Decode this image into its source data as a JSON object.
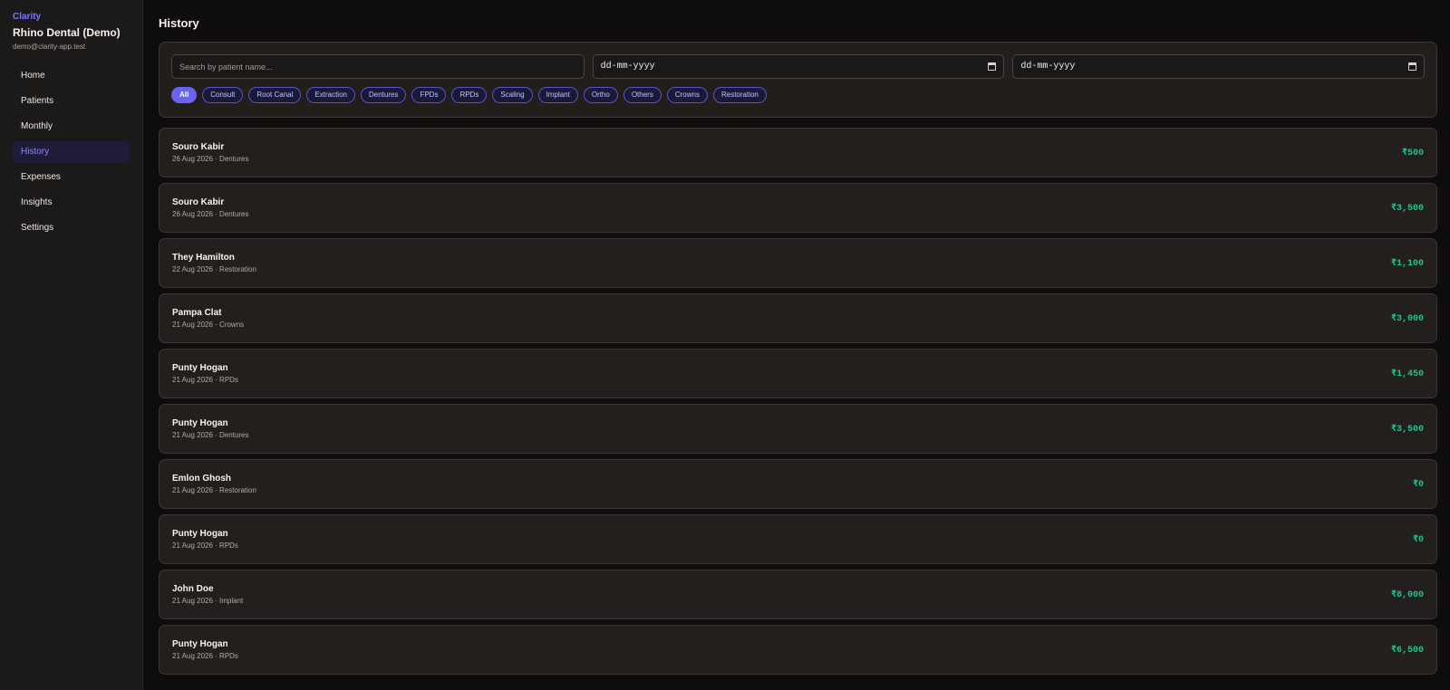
{
  "app": {
    "brand": "Clarity",
    "clinic": "Rhino Dental (Demo)",
    "email": "demo@clarity-app.test"
  },
  "nav": [
    {
      "label": "Home",
      "active": false
    },
    {
      "label": "Patients",
      "active": false
    },
    {
      "label": "Monthly",
      "active": false
    },
    {
      "label": "History",
      "active": true
    },
    {
      "label": "Expenses",
      "active": false
    },
    {
      "label": "Insights",
      "active": false
    },
    {
      "label": "Settings",
      "active": false
    }
  ],
  "page": {
    "title": "History"
  },
  "filters": {
    "search_placeholder": "Search by patient name...",
    "date_from": "dd-mm-yyyy",
    "date_to": "dd-mm-yyyy",
    "chips": [
      "All",
      "Consult",
      "Root Canal",
      "Extraction",
      "Dentures",
      "FPDs",
      "RPDs",
      "Scaling",
      "Implant",
      "Ortho",
      "Others",
      "Crowns",
      "Restoration"
    ],
    "active_chip": "All"
  },
  "records": [
    {
      "name": "Souro Kabir",
      "meta": "26 Aug 2026 · Dentures",
      "amount": "₹500"
    },
    {
      "name": "Souro Kabir",
      "meta": "26 Aug 2026 · Dentures",
      "amount": "₹3,500"
    },
    {
      "name": "They Hamilton",
      "meta": "22 Aug 2026 · Restoration",
      "amount": "₹1,100"
    },
    {
      "name": "Pampa Clat",
      "meta": "21 Aug 2026 · Crowns",
      "amount": "₹3,000"
    },
    {
      "name": "Punty Hogan",
      "meta": "21 Aug 2026 · RPDs",
      "amount": "₹1,450"
    },
    {
      "name": "Punty Hogan",
      "meta": "21 Aug 2026 · Dentures",
      "amount": "₹3,500"
    },
    {
      "name": "Emlon Ghosh",
      "meta": "21 Aug 2026 · Restoration",
      "amount": "₹0"
    },
    {
      "name": "Punty Hogan",
      "meta": "21 Aug 2026 · RPDs",
      "amount": "₹0"
    },
    {
      "name": "John Doe",
      "meta": "21 Aug 2026 · Implant",
      "amount": "₹8,000"
    },
    {
      "name": "Punty Hogan",
      "meta": "21 Aug 2026 · RPDs",
      "amount": "₹6,500"
    }
  ],
  "colors": {
    "accent": "#6a63f0",
    "amount": "#22c38e",
    "background": "#0f0d0c"
  }
}
